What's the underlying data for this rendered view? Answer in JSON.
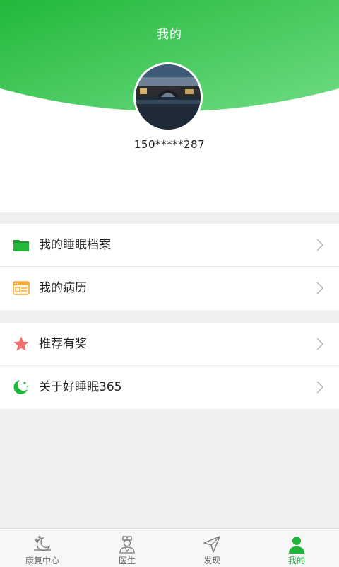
{
  "header": {
    "title": "我的"
  },
  "profile": {
    "phone": "150*****287"
  },
  "menu": {
    "group1": [
      {
        "label": "我的睡眠档案",
        "icon": "folder-icon"
      },
      {
        "label": "我的病历",
        "icon": "medical-record-icon"
      }
    ],
    "group2": [
      {
        "label": "推荐有奖",
        "icon": "star-icon"
      },
      {
        "label": "关于好睡眠365",
        "icon": "moon-stars-icon"
      }
    ]
  },
  "tabbar": {
    "items": [
      {
        "label": "康复中心",
        "icon": "moon-stars-icon",
        "active": false
      },
      {
        "label": "医生",
        "icon": "doctor-icon",
        "active": false
      },
      {
        "label": "发现",
        "icon": "navigation-arrow-icon",
        "active": false
      },
      {
        "label": "我的",
        "icon": "user-icon",
        "active": true
      }
    ]
  },
  "colors": {
    "accent": "#1db53a",
    "header_gradient_start": "#22b83a",
    "header_gradient_end": "#6fdc84",
    "background": "#eeeff1"
  }
}
